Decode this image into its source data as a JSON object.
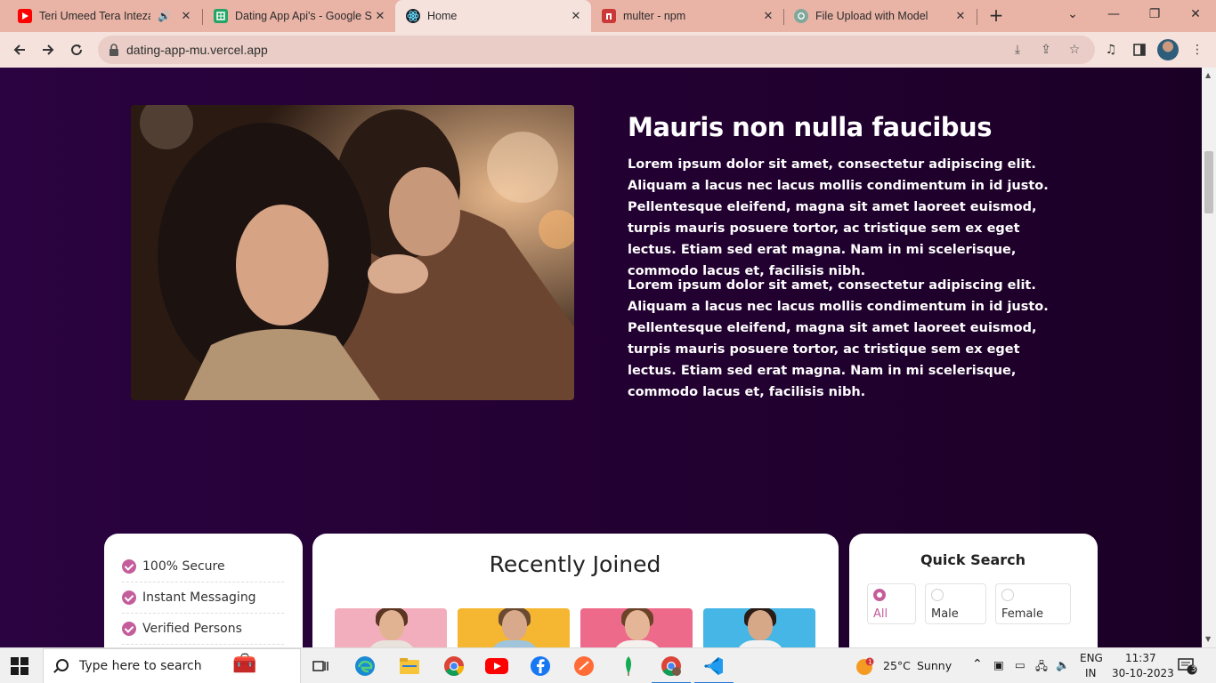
{
  "browser": {
    "tabs": [
      {
        "title": "Teri Umeed Tera Intezar",
        "icon": "youtube-icon",
        "audio": true,
        "active": false
      },
      {
        "title": "Dating App Api's - Google Sheets",
        "icon": "sheets-icon",
        "audio": false,
        "active": false
      },
      {
        "title": "Home",
        "icon": "react-icon",
        "audio": false,
        "active": true
      },
      {
        "title": "multer - npm",
        "icon": "npm-icon",
        "audio": false,
        "active": false
      },
      {
        "title": "File Upload with Model",
        "icon": "openai-icon",
        "audio": false,
        "active": false
      }
    ],
    "url": "dating-app-mu.vercel.app",
    "accent": "#e9b3a6"
  },
  "page": {
    "hero": {
      "title": "Mauris non nulla faucibus",
      "paragraphs": [
        "Lorem ipsum dolor sit amet, consectetur adipiscing elit. Aliquam a lacus nec lacus mollis condimentum in id justo. Pellentesque eleifend, magna sit amet laoreet euismod, turpis mauris posuere tortor, ac tristique sem ex eget lectus. Etiam sed erat magna. Nam in mi scelerisque, commodo lacus et, facilisis nibh.",
        "Lorem ipsum dolor sit amet, consectetur adipiscing elit. Aliquam a lacus nec lacus mollis condimentum in id justo. Pellentesque eleifend, magna sit amet laoreet euismod, turpis mauris posuere tortor, ac tristique sem ex eget lectus. Etiam sed erat magna. Nam in mi scelerisque, commodo lacus et, facilisis nibh."
      ]
    },
    "features": [
      "100% Secure",
      "Instant Messaging",
      "Verified Persons"
    ],
    "recently_joined": {
      "title": "Recently Joined",
      "members": [
        {
          "bg": "#f2aebd"
        },
        {
          "bg": "#f5b731"
        },
        {
          "bg": "#ee6a8a"
        },
        {
          "bg": "#46b6e6"
        }
      ]
    },
    "quick_search": {
      "title": "Quick Search",
      "genders": [
        "All",
        "Male",
        "Female"
      ],
      "selected": "All"
    },
    "brand_color": "#c35d9b"
  },
  "taskbar": {
    "search_placeholder": "Type here to search",
    "weather": {
      "temp": "25°C",
      "condition": "Sunny"
    },
    "language": {
      "lang": "ENG",
      "region": "IN"
    },
    "time": "11:37",
    "date": "30-10-2023",
    "notifications": "3"
  }
}
